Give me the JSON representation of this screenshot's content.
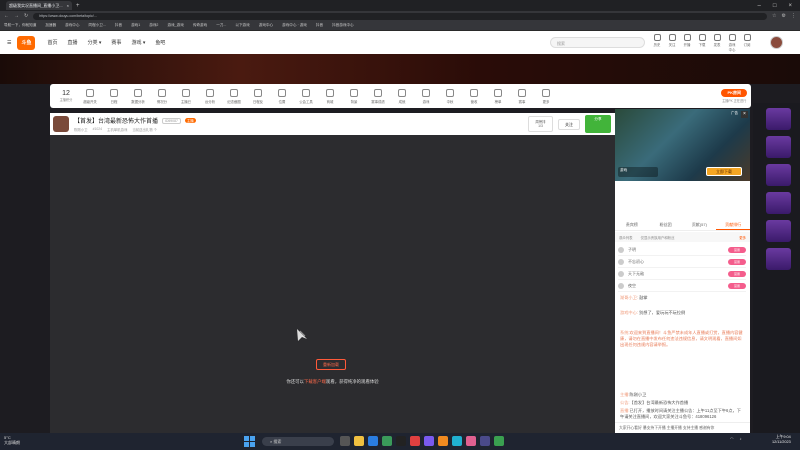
{
  "browser": {
    "tabs": [
      {
        "label": "超级我实况直播间_直播小卫..."
      }
    ],
    "url": "https://www.douyu.com/beta/topic/...",
    "bookmarks": [
      "导航一下，你就知道",
      "加速器",
      "游戏中心",
      "同程小卫...",
      "抖音",
      "游戏1",
      "游戏2",
      "游戏_游戏",
      "传奇游戏",
      "一刀...",
      "以下游戏",
      "游戏中心",
      "游戏中心 · 游戏",
      "抖音",
      "抖音游戏中心"
    ]
  },
  "site": {
    "logo": "斗鱼",
    "nav": [
      "首页",
      "直播",
      "分类 ▾",
      "赛事",
      "游戏 ▾",
      "鱼吧"
    ],
    "search_placeholder": "搜索",
    "top_icons": [
      "历史",
      "关注",
      "开播",
      "下载",
      "发表",
      "游戏中心",
      "订阅"
    ]
  },
  "toolbar": {
    "count": "12",
    "count_label": "主播积分",
    "items": [
      "超级开关",
      "日程",
      "数据分析",
      "情况分",
      "主播已",
      "台分析",
      "纪念截图",
      "日程反",
      "位置",
      "公会工具",
      "商城",
      "背景",
      "赛事成绩",
      "成就",
      "游戏",
      "中秋",
      "营收",
      "榜单",
      "赛事",
      "更多"
    ],
    "pk_label": "PK房间",
    "pk_sub": "主播PK 正在进行"
  },
  "room": {
    "title": "【首发】台湾最新恐怖大作首播",
    "tag1": "ID59087",
    "tag2": "主播",
    "anchor_name": "陈刚小卫",
    "meta1": "#1024",
    "meta2": "主机单机游戏",
    "meta3": "当前送出礼物  个",
    "rank_label": "周榜排",
    "rank_value": "1/3",
    "follow_label": "关注",
    "share_label": "分享",
    "reload_label": "重新加载",
    "tip_prefix": "你还可以",
    "tip_highlight": "下载客户端",
    "tip_suffix": "观看，获得纯净的观看体验"
  },
  "side": {
    "ad_tag": "广告",
    "ad_button": "立即下载",
    "ad_logo": "游戏",
    "chat_tabs": [
      "贵宾榜",
      "粉丝团",
      "贡献(57)",
      "贡献排行"
    ],
    "filter_left": "观众列表",
    "filter_mid": "仅显示贵族用户和粉丝",
    "filter_right": "更多",
    "ranks": [
      "子明",
      "不忘初心",
      "天下无敌",
      "夜空"
    ],
    "rank_badge": "富豪",
    "messages": [
      {
        "user": "湖哥小卫:",
        "text": "  鼓掌"
      },
      {
        "user": "游戏中心:",
        "text": "  别想了，爱玩玩不玩拉倒"
      },
      {
        "user": "系统:",
        "text": "欢迎来到直播间！斗鱼严禁未成年人直播或打赏，直播内容健康，请勿在直播中发布任何违法违规信息，请文明观看，直播间如出现任何违规内容请举报。"
      },
      {
        "user": "主播:",
        "text": "陈刚小卫"
      },
      {
        "user": "公告:",
        "text": "【首发】台湾最新恐怖大作首播"
      },
      {
        "user": "直播:",
        "text": "已打开，播放时间请关注主播公告：上午11点至下午6点，下午请关注直播间，欢迎大家关注斗鱼号：418096126"
      }
    ],
    "input_text": "大家开心看好 暴支持下开播 主播开播 支持主播 感谢有你"
  },
  "taskbar": {
    "weather_temp": "5°C",
    "weather_desc": "大部晴朗",
    "search": "搜索",
    "time": "上午9:04",
    "date": "12/11/2023"
  },
  "colors": {
    "accent": "#ff5500",
    "brand": "#ff6a00"
  }
}
